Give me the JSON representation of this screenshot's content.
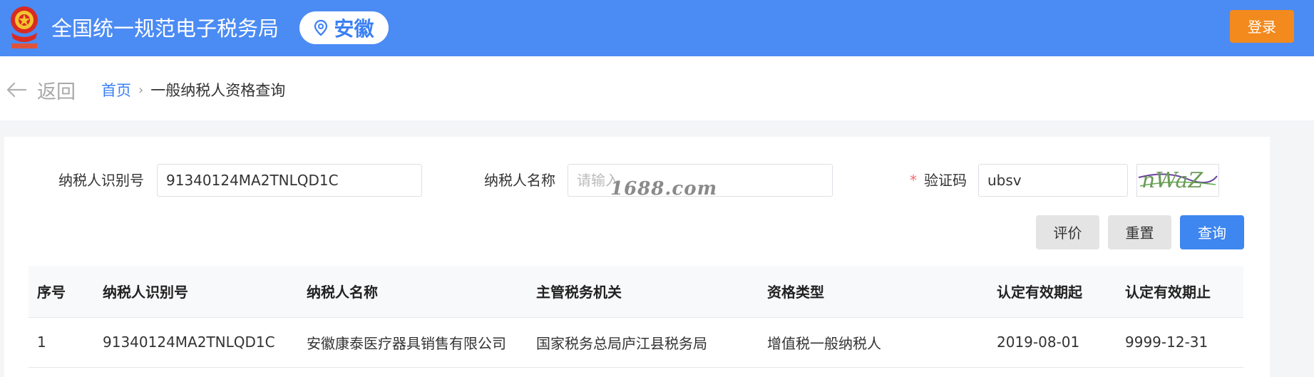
{
  "header": {
    "title": "全国统一规范电子税务局",
    "region": "安徽",
    "login_label": "登录",
    "colors": {
      "bar": "#4b8bf4",
      "login": "#f28a1e"
    }
  },
  "breadcrumb": {
    "back_label": "返回",
    "home_label": "首页",
    "current_label": "一般纳税人资格查询"
  },
  "form": {
    "taxpayer_id_label": "纳税人识别号",
    "taxpayer_id_value": "91340124MA2TNLQD1C",
    "taxpayer_name_label": "纳税人名称",
    "taxpayer_name_placeholder": "请输入",
    "captcha_required_mark": "*",
    "captcha_label": "验证码",
    "captcha_value": "ubsv",
    "captcha_image_text": "nWaZ",
    "watermark": "1688.com"
  },
  "actions": {
    "evaluate_label": "评价",
    "reset_label": "重置",
    "query_label": "查询"
  },
  "table": {
    "columns": [
      "序号",
      "纳税人识别号",
      "纳税人名称",
      "主管税务机关",
      "资格类型",
      "认定有效期起",
      "认定有效期止"
    ],
    "rows": [
      [
        "1",
        "91340124MA2TNLQD1C",
        "安徽康泰医疗器具销售有限公司",
        "国家税务总局庐江县税务局",
        "增值税一般纳税人",
        "2019-08-01",
        "9999-12-31"
      ]
    ]
  }
}
